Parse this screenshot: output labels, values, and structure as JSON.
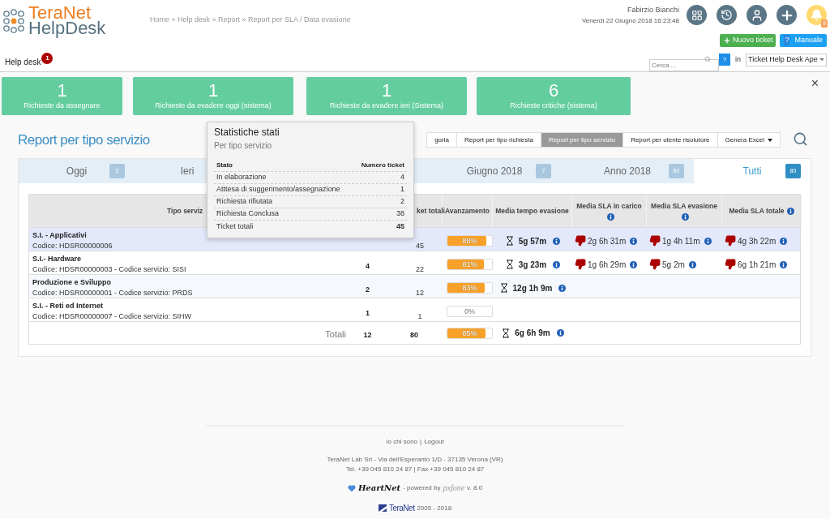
{
  "header": {
    "logo": {
      "line1": "TeraNet",
      "line2": "HelpDesk"
    },
    "breadcrumb": "Home » Help desk » Report » Report per SLA / Data evasione",
    "user": {
      "name": "Fabirzio Bianchi",
      "datetime": "Venerdì 22 Giugno 2018 16:23:48"
    },
    "notifications_badge": "9",
    "buttons": [
      {
        "kind": "new",
        "label": "Nuovo ticket"
      },
      {
        "kind": "help",
        "icon_text": "?",
        "label": "Manuale"
      }
    ],
    "search": {
      "placeholder": "Cerca ...",
      "help": "?",
      "in_label": "in",
      "scope": "Ticket Help Desk Ape"
    },
    "nav": {
      "label": "Help desk",
      "badge": "1"
    }
  },
  "cards": [
    {
      "count": "1",
      "label": "Richieste da assegnare"
    },
    {
      "count": "1",
      "label": "Richieste da evadere oggi (sistema)"
    },
    {
      "count": "1",
      "label": "Richieste da evadere ieri (Sistema)"
    },
    {
      "count": "6",
      "label": "Richieste critiche (sistema)"
    }
  ],
  "close": "×",
  "report": {
    "title": "Report per tipo servizio",
    "views": [
      {
        "label": "goria",
        "selected": false
      },
      {
        "label": "Report per tipo richiesta",
        "selected": false
      },
      {
        "label": "Report per tipo servizio",
        "selected": true
      },
      {
        "label": "Report per utente risolutore",
        "selected": false
      }
    ],
    "excel": "Genera Excel"
  },
  "tabs": [
    {
      "label": "Oggi",
      "count": "3",
      "selected": false
    },
    {
      "label": "Ieri",
      "selected": false
    },
    {
      "label": "Giugno 2018",
      "count": "7",
      "selected": false
    },
    {
      "label": "Anno 2018",
      "count": "80",
      "selected": false
    },
    {
      "label": "Tutti",
      "count": "80",
      "selected": true
    }
  ],
  "table": {
    "columns": [
      {
        "label": "Tipo serviz"
      },
      {
        "label": "ket totali"
      },
      {
        "label": "Avanzamento"
      },
      {
        "label": "Media tempo evasione"
      },
      {
        "label": "Media SLA in carico",
        "info": true
      },
      {
        "label": "Media SLA evasione",
        "info": true
      },
      {
        "label": "Media SLA totale",
        "info": true
      }
    ],
    "rows": [
      {
        "name": "S.I. - Applicativi",
        "code": "Codice: HDSR00000006",
        "total": "45",
        "level": 0.88,
        "percent": "88%",
        "avg_time": "5g 57m",
        "sla_carico": "2g 6h 31m",
        "sla_evasione": "1g 4h 11m",
        "sla_totale": "4g 3h 22m",
        "selected": true
      },
      {
        "name": "S.I.- Hardware",
        "code": "Codice: HDSR00000003 - Codice servizio: SISI",
        "open": "4",
        "total": "22",
        "level": 0.81,
        "percent": "81%",
        "avg_time": "3g 23m",
        "sla_carico": "1g 6h 29m",
        "sla_evasione": "5g 2m",
        "sla_totale": "6g 1h 21m",
        "selected": false
      },
      {
        "name": "Produzione e Sviluppo",
        "code": "Codice: HDSR00000001 - Codice servizio: PRDS",
        "open": "2",
        "total": "12",
        "level": 0.83,
        "percent": "83%",
        "avg_time": "12g 1h 9m",
        "selected": false
      },
      {
        "name": "S.I. - Reti ed Internet",
        "code": "Codice: HDSR00000007 - Codice servizio: SIHW",
        "open": "1",
        "total": "1",
        "level": 0,
        "percent": "0%",
        "selected": false
      }
    ],
    "totals": {
      "label": "Totali",
      "open": "12",
      "total": "80",
      "level": 0.85,
      "percent": "85%",
      "avg_time": "6g 6h 9m"
    }
  },
  "popover": {
    "title": "Statistiche stati",
    "subtitle": "Per tipo servizio",
    "columns": [
      "Stato",
      "Numero ticket"
    ],
    "rows": [
      {
        "label": "In elaborazione",
        "value": "4"
      },
      {
        "label": "Atttesa di suggerimento/assegnazione",
        "value": "1"
      },
      {
        "label": "Richiesta rifiutata",
        "value": "2"
      },
      {
        "label": "Richiesta Conclusa",
        "value": "38"
      }
    ],
    "total": {
      "label": "Ticket totali",
      "value": "45"
    }
  },
  "footer": {
    "links": [
      "Io chi sono",
      "Logout"
    ],
    "separator": "|",
    "address": [
      "TeraNet Lab Srl - Via dell'Esperanto 1/D - 37135 Verona (VR)",
      "Tel. +39 045 810 24 87 | Fax +39 045 810 24 87"
    ],
    "powered": {
      "brand": "HeartNet",
      "text": "- powered by",
      "product": "pxfone",
      "version": "v. 8.0"
    },
    "copyright": {
      "brand": "TeraNet",
      "years": "2005 - 2018"
    }
  }
}
